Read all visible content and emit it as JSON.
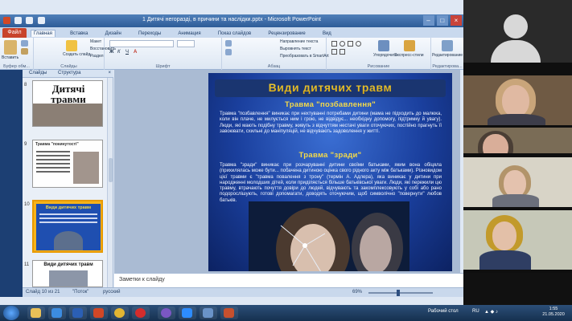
{
  "window": {
    "title": "1 Дитячі негоразді, в причини та наслідки.pptx - Microsoft PowerPoint"
  },
  "ribbon": {
    "file_tab": "Файл",
    "tabs": [
      "Главная",
      "Вставка",
      "Дизайн",
      "Переходы",
      "Анимация",
      "Показ слайдов",
      "Рецензирование",
      "Вид"
    ],
    "groups": {
      "clipboard": "Буфер обм...",
      "slides": "Слайды",
      "font": "Шрифт",
      "paragraph": "Абзац",
      "drawing": "Рисование",
      "editing": "Редактирова..."
    },
    "buttons": {
      "paste": "Вставить",
      "create_slide": "Создать слайд",
      "layout": "Макет",
      "reset": "Восстановить",
      "section": "Раздел",
      "text_direction": "Направление текста",
      "align_text": "Выровнять текст",
      "smartart": "Преобразовать в SmartArt",
      "arrange": "Упорядочить",
      "quick_styles": "Экспресс-стили",
      "editing": "Редактирование"
    }
  },
  "panel": {
    "tab_slides": "Слайды",
    "tab_outline": "Структура",
    "close": "×",
    "thumbs": [
      {
        "num": "8",
        "title": "Дитячі травми"
      },
      {
        "num": "9",
        "title": "Травма \"покинутості\""
      },
      {
        "num": "10",
        "title": "Види дитячих травм"
      },
      {
        "num": "11",
        "title": "Види дитячих травм"
      }
    ]
  },
  "slide": {
    "title": "Види дитячих травм",
    "section1": "Травма \"позбавлення\"",
    "text1": "Травма \"позбавлення\" виникає при нехтуванні потребами дитини (мама не підходить до малюка, коли він плаче, не милується ним і грою, не відвідує... необхідну допомогу, підтримку й увагу). Люди, які мають подібну травму, живуть з відчуттям нестачі уваги оточуючих, постійно прагнуть її завоювати, схильні до маніпуляцій, не відчувають задоволення у житті.",
    "section2": "Травма \"зради\"",
    "text2": "Травма \"зради\" виникає при розчаруванні дитини своїми батьками, яким вона обіцяла (прихилялась може бути... побачена дитиною оцінка свого рідного акту між батьками). Різновидом цієї травми є \"травма повалення з трону\" (термін А. Адлера), яка виникає у дитини при народженні молодших дітей, коли приділяється більше батьківської уваги. Люди, які пережили цю травму, втрачають почуття довіри до людей, відчувають та закомплексовують у собі або рано подорослішують, готові допомагати, доводять оточуючим, щоб символічно \"повернути\" любов батьків."
  },
  "notes": {
    "placeholder": "Заметки к слайду"
  },
  "statusbar": {
    "slide_info": "Слайд 10 из 21",
    "theme": "\"Поток\"",
    "language": "русский",
    "zoom": "69%"
  },
  "taskbar": {
    "language": "RU",
    "desktop": "Рабочий стол",
    "time": "1:55",
    "date": "21.05.2020"
  },
  "colors": {
    "slide_bg": "#1a3f9d",
    "title_gold": "#f3d94a",
    "file_tab": "#c8442b",
    "accent_blue": "#2e5c98"
  }
}
